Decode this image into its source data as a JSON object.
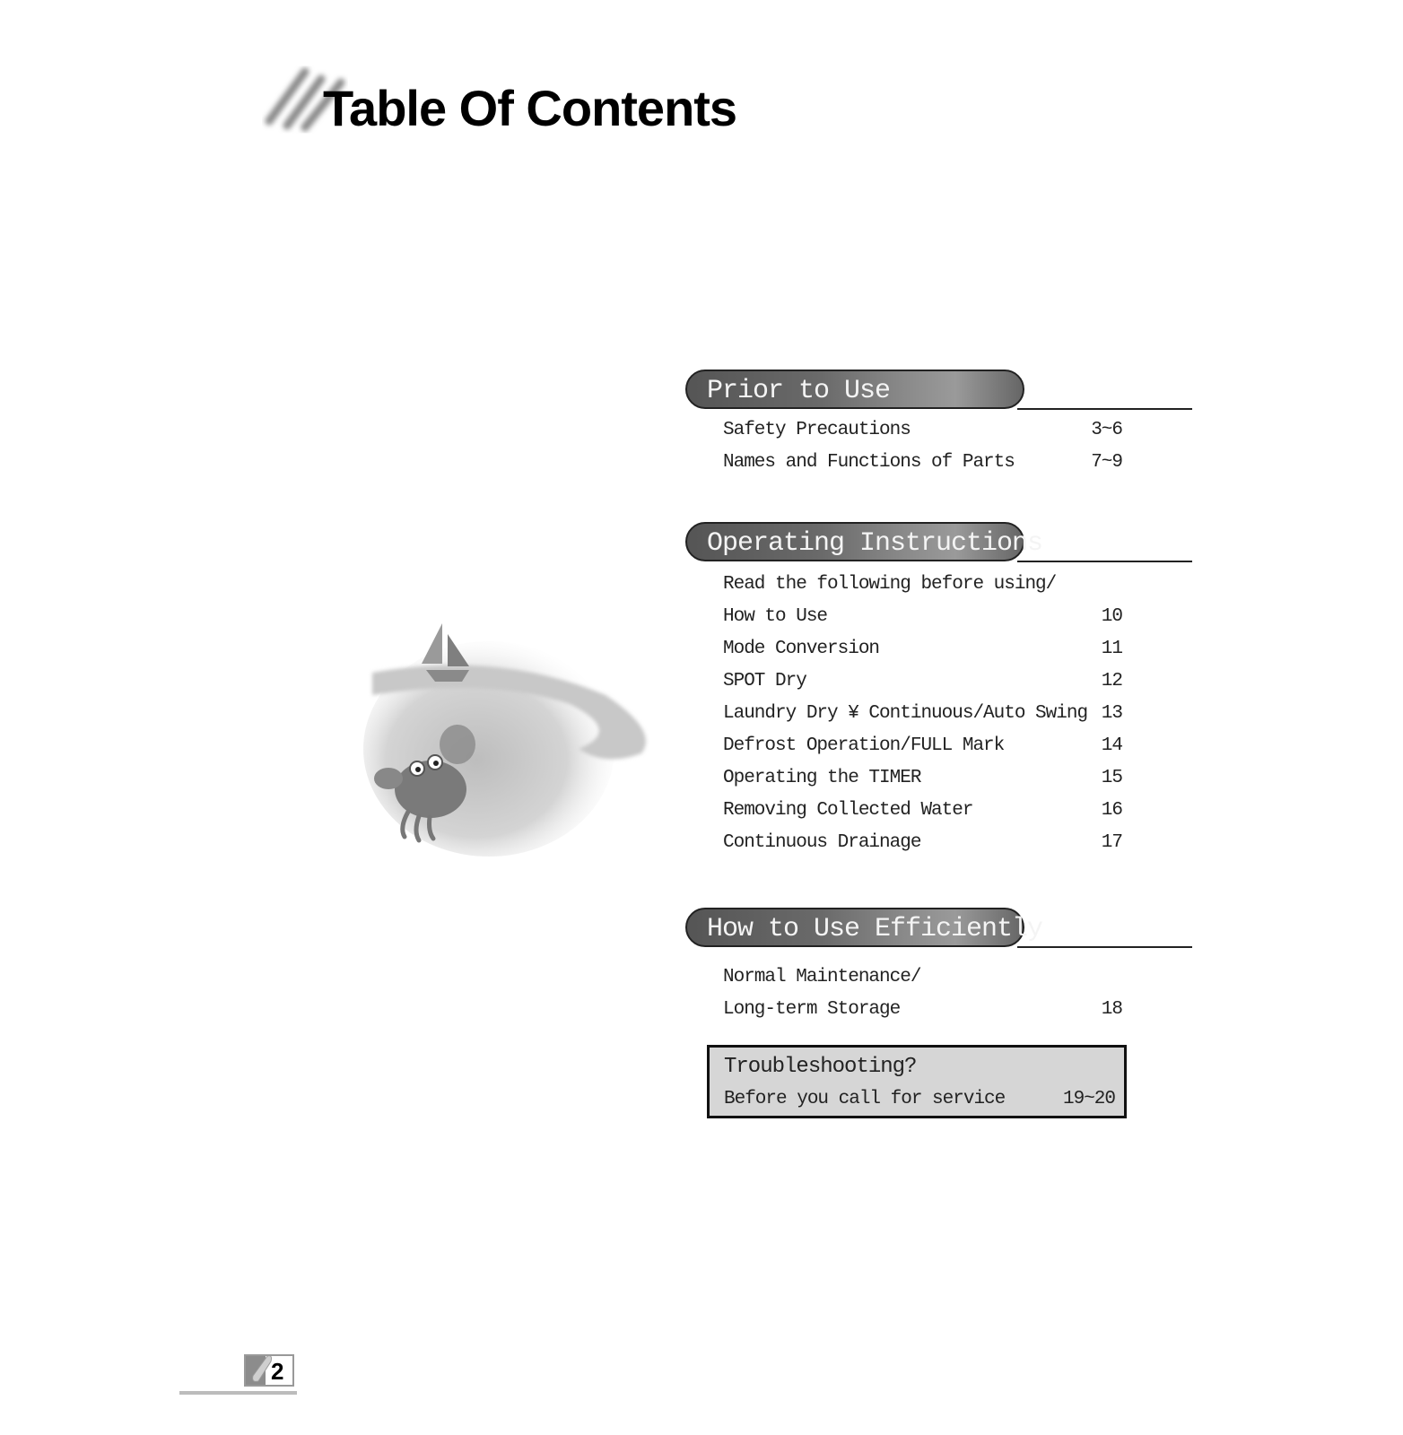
{
  "header": {
    "title": "Table Of Contents"
  },
  "sections": [
    {
      "title": "Prior to Use",
      "entries": [
        {
          "label": "Safety Precautions",
          "page": "3~6"
        },
        {
          "label": "Names and Functions of Parts",
          "page": "7~9"
        }
      ]
    },
    {
      "title": "Operating Instructions",
      "entries": [
        {
          "label": "Read the following before using/",
          "page": ""
        },
        {
          "label": "How to Use",
          "page": "10"
        },
        {
          "label": "Mode Conversion",
          "page": "11"
        },
        {
          "label": "SPOT Dry",
          "page": "12"
        },
        {
          "label": "Laundry Dry ¥ Continuous/Auto Swing",
          "page": "13"
        },
        {
          "label": "Defrost Operation/FULL Mark",
          "page": "14"
        },
        {
          "label": "Operating the TIMER",
          "page": "15"
        },
        {
          "label": "Removing Collected Water",
          "page": "16"
        },
        {
          "label": "Continuous Drainage",
          "page": "17"
        }
      ]
    },
    {
      "title": "How to Use Efficiently",
      "entries": [
        {
          "label": "Normal Maintenance/",
          "page": ""
        },
        {
          "label": "Long-term Storage",
          "page": "18"
        }
      ]
    }
  ],
  "troubleshooting": {
    "title": "Troubleshooting?",
    "label": "Before you call for service",
    "page": "19~20"
  },
  "footer": {
    "page_number": "2"
  },
  "illustration": {
    "description": "Sailboat on water with a crab"
  }
}
